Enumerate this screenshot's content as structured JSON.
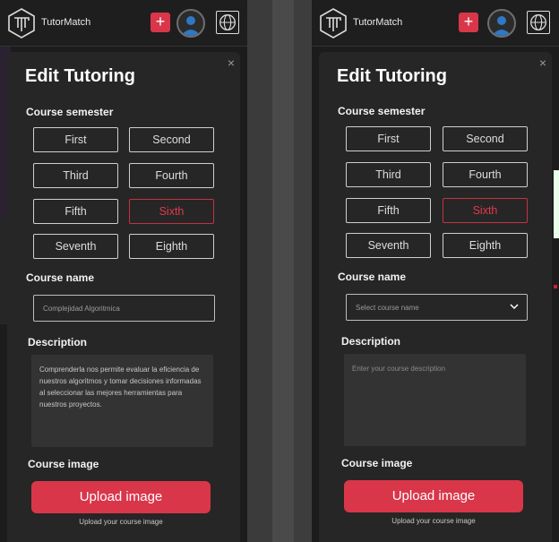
{
  "app": {
    "brand": "TutorMatch",
    "add_symbol": "+"
  },
  "colors": {
    "accent": "#d9364a",
    "bg": "#1c1c1c",
    "modal": "#262626"
  },
  "left": {
    "modal_title": "Edit Tutoring",
    "close_symbol": "×",
    "semester_label": "Course semester",
    "semesters": [
      "First",
      "Second",
      "Third",
      "Fourth",
      "Fifth",
      "Sixth",
      "Seventh",
      "Eighth"
    ],
    "selected_semester": "Sixth",
    "course_name_label": "Course name",
    "course_name_value": "Complejidad Algoritmica",
    "description_label": "Description",
    "description_value": "Comprenderla nos permite evaluar la eficiencia de nuestros algoritmos y tomar decisiones informadas al seleccionar las mejores herramientas para nuestros proyectos.",
    "image_label": "Course image",
    "upload_label": "Upload image",
    "upload_hint": "Upload your course image"
  },
  "right": {
    "modal_title": "Edit Tutoring",
    "close_symbol": "×",
    "semester_label": "Course semester",
    "semesters": [
      "First",
      "Second",
      "Third",
      "Fourth",
      "Fifth",
      "Sixth",
      "Seventh",
      "Eighth"
    ],
    "selected_semester": "Sixth",
    "course_name_label": "Course name",
    "course_name_placeholder": "Select course name",
    "description_label": "Description",
    "description_placeholder": "Enter your course description",
    "image_label": "Course image",
    "upload_label": "Upload image",
    "upload_hint": "Upload your course image"
  },
  "icons": [
    "tutormatch-logo-icon",
    "plus-icon",
    "avatar-icon",
    "globe-icon",
    "close-icon",
    "chevron-down-icon"
  ]
}
